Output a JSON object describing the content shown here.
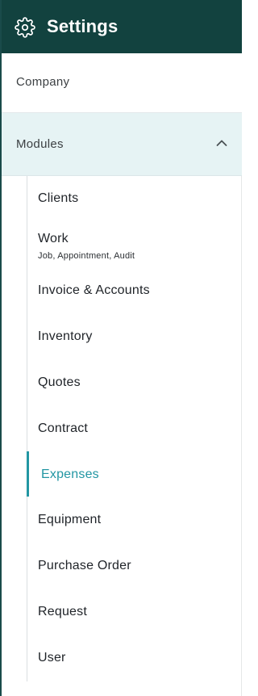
{
  "header": {
    "icon": "gear-icon",
    "title": "Settings",
    "background": "#12423f"
  },
  "nav": {
    "company_label": "Company",
    "modules_label": "Modules",
    "modules_expanded": true,
    "modules_chevron_icon": "chevron-up-icon"
  },
  "submenu": {
    "accent_color": "#2296a3",
    "items": [
      {
        "label": "Clients"
      },
      {
        "label": "Work",
        "sublabel": "Job, Appointment, Audit"
      },
      {
        "label": "Invoice & Accounts"
      },
      {
        "label": "Inventory"
      },
      {
        "label": "Quotes"
      },
      {
        "label": "Contract"
      },
      {
        "label": "Expenses",
        "active": true
      },
      {
        "label": "Equipment"
      },
      {
        "label": "Purchase Order"
      },
      {
        "label": "Request"
      },
      {
        "label": "User"
      }
    ]
  }
}
